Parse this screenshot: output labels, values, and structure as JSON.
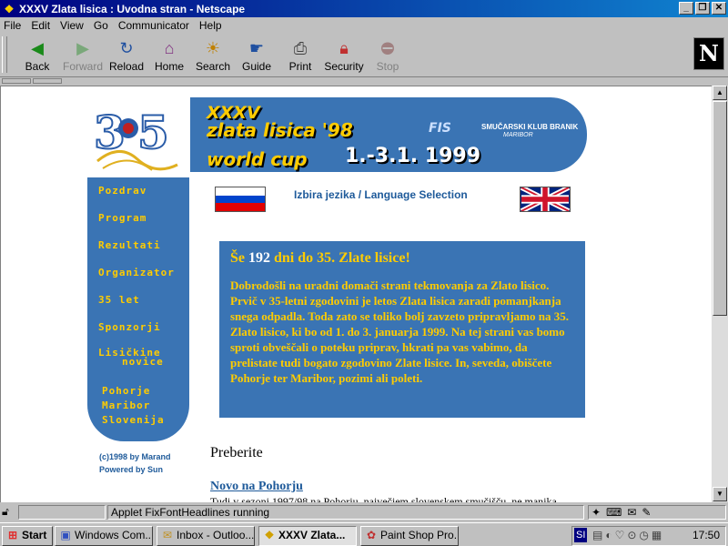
{
  "window": {
    "title": "XXXV Zlata lisica : Uvodna stran - Netscape"
  },
  "menu": [
    "File",
    "Edit",
    "View",
    "Go",
    "Communicator",
    "Help"
  ],
  "toolbar": [
    {
      "label": "Back",
      "icon": "back-arrow-icon",
      "enabled": true
    },
    {
      "label": "Forward",
      "icon": "forward-arrow-icon",
      "enabled": false
    },
    {
      "label": "Reload",
      "icon": "reload-icon",
      "enabled": true
    },
    {
      "label": "Home",
      "icon": "home-icon",
      "enabled": true
    },
    {
      "label": "Search",
      "icon": "search-icon",
      "enabled": true
    },
    {
      "label": "Guide",
      "icon": "guide-icon",
      "enabled": true
    },
    {
      "label": "Print",
      "icon": "print-icon",
      "enabled": true
    },
    {
      "label": "Security",
      "icon": "lock-icon",
      "enabled": true
    },
    {
      "label": "Stop",
      "icon": "stop-icon",
      "enabled": false
    }
  ],
  "banner": {
    "line1": "XXXV",
    "line2": "zlata lisica '98",
    "line3": "world cup",
    "dates": "1.-3.1. 1999",
    "fis": "FIS",
    "club": "SMUČARSKI KLUB BRANIK",
    "club_city": "MARIBOR"
  },
  "nav": {
    "items": [
      "Pozdrav",
      "Program",
      "Rezultati",
      "Organizator",
      "35 let",
      "Sponzorji",
      "Lisičkine",
      "novice",
      "Pohorje",
      "Maribor",
      "Slovenija"
    ]
  },
  "credits": {
    "line1": "(c)1998 by Marand",
    "line2": "Powered by Sun"
  },
  "language": {
    "label": "Izbira jezika / Language Selection"
  },
  "info": {
    "heading_pre": "Še",
    "heading_num": "192",
    "heading_post": "dni do 35. Zlate lisice!",
    "paragraph": "Dobrodošli na uradni domači strani tekmovanja za Zlato lisico. Prvič v 35-letni zgodovini je letos Zlata lisica zaradi pomanjkanja snega odpadla. Toda zato se toliko bolj zavzeto pripravljamo na 35. Zlato lisico, ki bo od 1. do 3. januarja 1999. Na tej strani vas bomo sproti obveščali o poteku priprav, hkrati pa vas vabimo, da prelistate tudi bogato zgodovino Zlate lisice. In, seveda, obiščete Pohorje ter Maribor, pozimi ali poleti."
  },
  "news": {
    "heading": "Preberite",
    "link": "Novo na Pohorju",
    "snippet": "Tudi v sezoni 1997/98 na Pohorju, največjem slovenskem smučišču, ne manjka"
  },
  "status": {
    "text": "Applet FixFontHeadlines running"
  },
  "taskbar": {
    "start": "Start",
    "items": [
      "Windows Com...",
      "Inbox - Outloo...",
      "XXXV Zlata...",
      "Paint Shop Pro..."
    ],
    "lang": "SI",
    "clock": "17:50"
  }
}
